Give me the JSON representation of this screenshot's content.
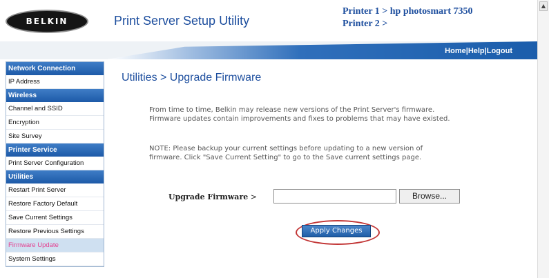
{
  "header": {
    "logo_text": "BELKIN",
    "app_title": "Print Server Setup Utility",
    "printer1": "Printer 1 > hp photosmart 7350",
    "printer2": "Printer 2 >"
  },
  "top_links": {
    "home": "Home",
    "sep1": "|",
    "help": "Help",
    "sep2": "|",
    "logout": "Logout"
  },
  "sidebar": {
    "sections": [
      {
        "title": "Network Connection",
        "items": [
          "IP Address"
        ]
      },
      {
        "title": "Wireless",
        "items": [
          "Channel and SSID",
          "Encryption",
          "Site Survey"
        ]
      },
      {
        "title": "Printer Service",
        "items": [
          "Print Server Configuration"
        ]
      },
      {
        "title": "Utilities",
        "items": [
          "Restart Print Server",
          "Restore Factory Default",
          "Save Current Settings",
          "Restore Previous Settings",
          "Firmware Update",
          "System Settings"
        ]
      }
    ],
    "active_item": "Firmware Update"
  },
  "main": {
    "page_title": "Utilities > Upgrade Firmware",
    "paragraph1": "From time to time, Belkin may release new versions of the Print Server's firmware. Firmware updates contain improvements and fixes to problems that may have existed.",
    "paragraph2": "NOTE: Please backup your current settings before updating to a new version of firmware. Click \"Save Current Setting\" to go to the Save current settings page.",
    "upgrade_label": "Upgrade Firmware",
    "upgrade_arrow": " >",
    "file_value": "",
    "browse_label": "Browse...",
    "apply_label": "Apply Changes"
  },
  "colors": {
    "brand_blue": "#1d4e9e",
    "section_blue": "#1d5aa8",
    "active_item_text": "#e43f8f",
    "highlight_ring": "#c23636"
  },
  "icons": {
    "scroll_up": "scroll-up-arrow-icon"
  }
}
